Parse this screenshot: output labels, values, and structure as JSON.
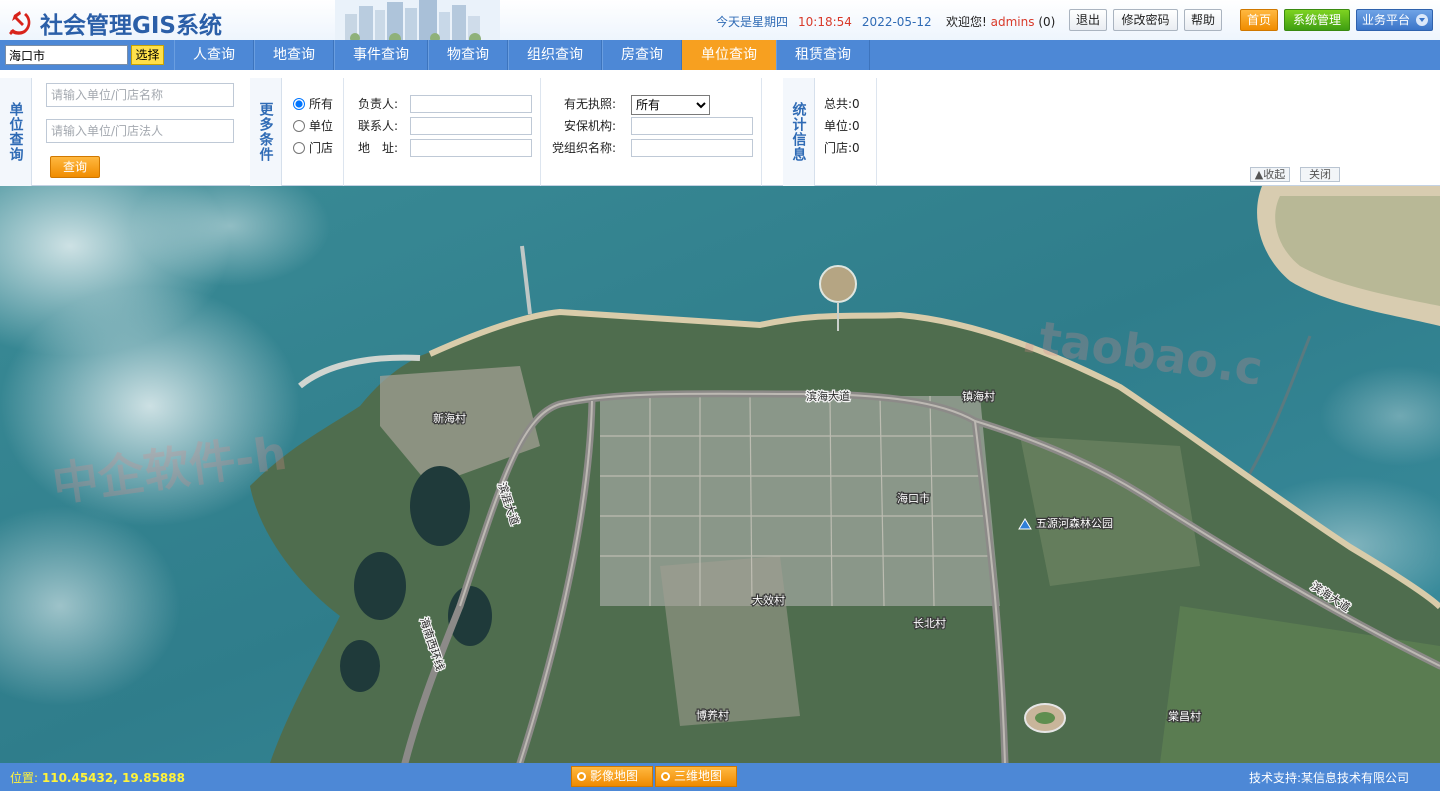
{
  "header": {
    "app_title": "社会管理GIS系统",
    "date_day": "今天是星期四",
    "time": "10:18:54",
    "date": "2022-05-12",
    "welcome": "欢迎您!",
    "username": "admins",
    "user_count": "(0)",
    "logout": "退出",
    "change_password": "修改密码",
    "help": "帮助",
    "home": "首页",
    "system_admin": "系统管理",
    "business_platform": "业务平台"
  },
  "nav": {
    "region_value": "海口市",
    "region_select": "选择",
    "tabs": [
      {
        "label": "人查询"
      },
      {
        "label": "地查询"
      },
      {
        "label": "事件查询"
      },
      {
        "label": "物查询"
      },
      {
        "label": "组织查询"
      },
      {
        "label": "房查询"
      },
      {
        "label": "单位查询",
        "active": true
      },
      {
        "label": "租赁查询"
      }
    ]
  },
  "query_panel": {
    "section_title": "单位查询",
    "name_placeholder": "请输入单位/门店名称",
    "legal_placeholder": "请输入单位/门店法人",
    "query_button": "查询",
    "more_title": "更多条件",
    "radios": [
      "所有",
      "单位",
      "门店"
    ],
    "fields_left": [
      "负责人:",
      "联系人:",
      "地　址:"
    ],
    "fields_right": [
      "有无执照:",
      "安保机构:",
      "党组织名称:"
    ],
    "license_options": [
      "所有"
    ],
    "stats_title": "统计信息",
    "stats": [
      {
        "label": "总共:",
        "value": "0"
      },
      {
        "label": "单位:",
        "value": "0"
      },
      {
        "label": "门店:",
        "value": "0"
      }
    ],
    "collapse": "收起",
    "close": "关闭"
  },
  "map": {
    "labels": {
      "road_binhai": "滨海大道",
      "road_binhai_east": "滨海大道",
      "road_binyong": "滨涯大道",
      "road_ring": "海南西环线",
      "xinhai": "新海村",
      "zhenhai": "镇海村",
      "haikou": "海口市",
      "park": "五源河森林公园",
      "dawen": "大效村",
      "changbei": "长北村",
      "boyang": "博养村",
      "tangchang": "棠昌村"
    },
    "watermark_left": "中企软件-h",
    "watermark_right": ".taobao.c"
  },
  "status": {
    "position_label": "位置:",
    "position_value": "110.45432, 19.85888",
    "satellite": "影像地图",
    "three_d": "三维地图",
    "tech_support": "技术支持:某信息技术有限公司"
  },
  "colors": {
    "nav_blue": "#4d88d6",
    "active_orange": "#f7a020",
    "title_blue": "#2b5fa8",
    "time_red": "#d83a2a"
  }
}
